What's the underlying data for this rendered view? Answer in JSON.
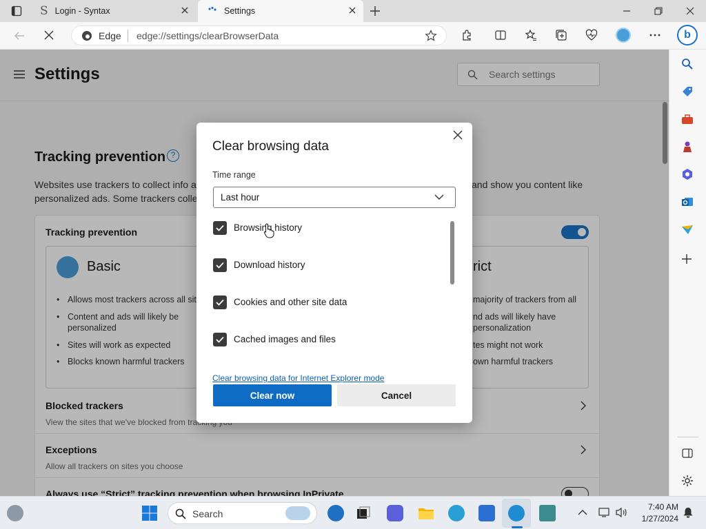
{
  "browser": {
    "tabs": [
      {
        "title": "Login - Syntax"
      },
      {
        "title": "Settings"
      }
    ],
    "address": {
      "brand": "Edge",
      "url": "edge://settings/clearBrowserData"
    }
  },
  "settings": {
    "title": "Settings",
    "search_placeholder": "Search settings",
    "tracking_title": "Tracking prevention",
    "tracking_desc_1": "Websites use trackers to collect info ab",
    "tracking_desc_1b": "and show you content like",
    "tracking_desc_2": "personalized ads. Some trackers collec",
    "card_title": "Tracking prevention",
    "basic": {
      "title": "Basic",
      "bullets": [
        "Allows most trackers across all sites",
        "Content and ads will likely be personalized",
        "Sites will work as expected",
        "Blocks known harmful trackers"
      ]
    },
    "strict": {
      "title": "rict",
      "bullets": [
        "majority of trackers from all",
        "nd ads will likely have personalization",
        "tes might not work",
        "own harmful trackers"
      ]
    },
    "blocked": {
      "title": "Blocked trackers",
      "desc": "View the sites that we've blocked from tracking you"
    },
    "exceptions": {
      "title": "Exceptions",
      "desc": "Allow all trackers on sites you choose"
    },
    "inprivate": "Always use “Strict” tracking prevention when browsing InPrivate"
  },
  "dialog": {
    "title": "Clear browsing data",
    "time_range_label": "Time range",
    "time_range_value": "Last hour",
    "options": [
      {
        "label": "Browsing history",
        "checked": true
      },
      {
        "label": "Download history",
        "checked": true
      },
      {
        "label": "Cookies and other site data",
        "checked": true
      },
      {
        "label": "Cached images and files",
        "checked": true
      }
    ],
    "ie_link": "Clear browsing data for Internet Explorer mode",
    "clear_label": "Clear now",
    "cancel_label": "Cancel"
  },
  "taskbar": {
    "search_label": "Search",
    "time": "7:40 AM",
    "date": "1/27/2024"
  }
}
